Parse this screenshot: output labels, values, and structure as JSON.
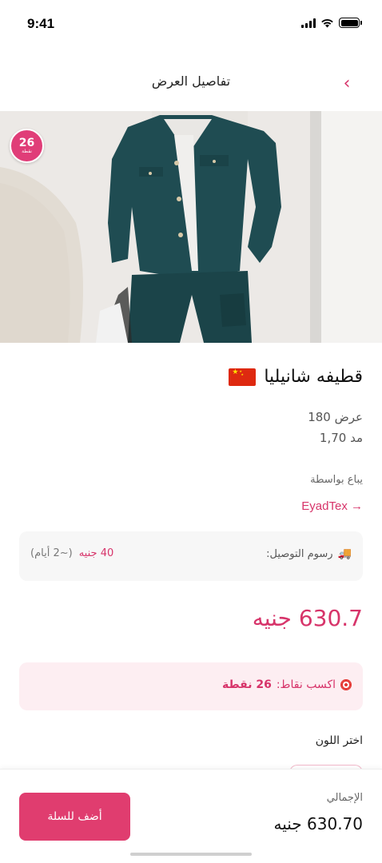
{
  "status_bar": {
    "time": "9:41"
  },
  "header": {
    "title": "تفاصيل العرض",
    "back_glyph": "‹"
  },
  "hero": {
    "points_badge_value": "26",
    "points_badge_label": "نقطة"
  },
  "product": {
    "title": "قطيفه شانيليا",
    "flag": "china-flag",
    "width_spec": "عرض 180",
    "length_spec": "مد 1,70",
    "sold_by_label": "يباع بواسطة",
    "seller_name": "EyadTex →"
  },
  "delivery": {
    "label": "رسوم التوصيل:",
    "fee": "40 جنيه",
    "days": "(~2 أيام)"
  },
  "price": "630.7 جنيه",
  "points": {
    "label": "اكسب نقاط:",
    "value": "26 نقطة"
  },
  "color_section": {
    "label": "اختر اللون"
  },
  "bottom_bar": {
    "add_to_cart_label": "أضف للسلة",
    "total_label": "الإجمالي",
    "total_value": "630.70 جنيه"
  },
  "colors": {
    "accent": "#d7346a",
    "button": "#e03d6f",
    "points_bg": "#fdeef2"
  }
}
